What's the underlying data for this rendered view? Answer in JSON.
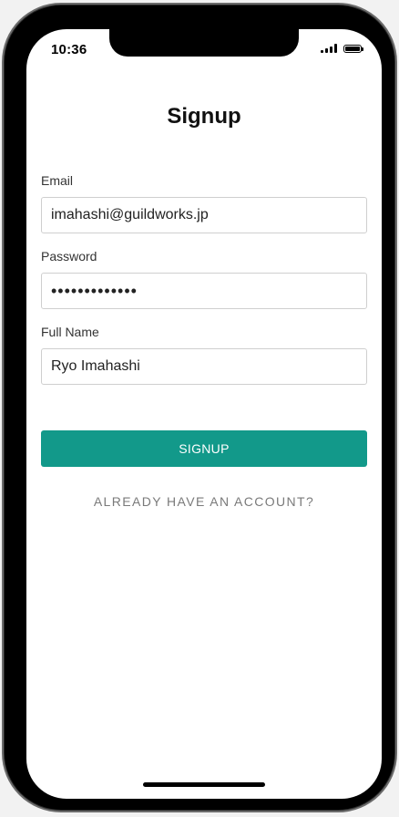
{
  "status_bar": {
    "time": "10:36",
    "signal_icon": "cellular-signal-icon",
    "battery_icon": "battery-icon",
    "battery_level": 1.0
  },
  "page": {
    "title": "Signup"
  },
  "form": {
    "email": {
      "label": "Email",
      "value": "imahashi@guildworks.jp"
    },
    "password": {
      "label": "Password",
      "value": "•••••••••••••"
    },
    "full_name": {
      "label": "Full Name",
      "value": "Ryo Imahashi"
    }
  },
  "actions": {
    "signup_label": "SIGNUP",
    "account_link_label": "ALREADY HAVE AN ACCOUNT?"
  },
  "colors": {
    "accent": "#12998a",
    "link": "#7a7a7a"
  }
}
